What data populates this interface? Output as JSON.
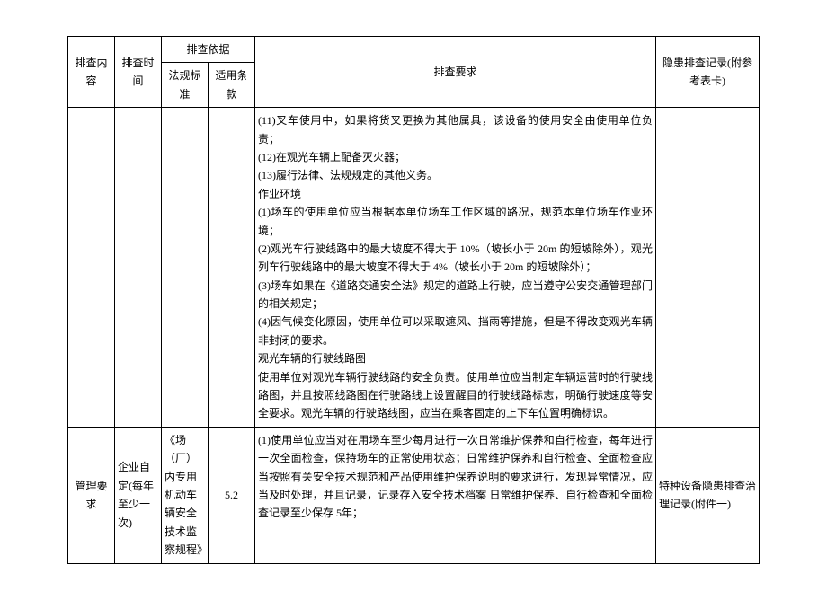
{
  "headers": {
    "col1": "排查内容",
    "col2": "排查时间",
    "col3_group": "排查依据",
    "col3a": "法规标准",
    "col3b": "适用条款",
    "col4": "排查要求",
    "col5": "隐患排查记录(附参考表卡)"
  },
  "row1": {
    "content": "",
    "time": "",
    "basis_std": "",
    "basis_clause": "",
    "req_p1": "(11)叉车使用中，如果将货叉更换为其他属具，该设备的使用安全由使用单位负责；",
    "req_p2": "(12)在观光车辆上配备灭火器；",
    "req_p3": "(13)履行法律、法规规定的其他义务。",
    "req_p4": "作业环境",
    "req_p5": "(1)场车的使用单位应当根据本单位场车工作区域的路况，规范本单位场车作业环境；",
    "req_p6": "(2)观光车行驶线路中的最大坡度不得大于 10%（坡长小于 20m 的短坡除外），观光列车行驶线路中的最大坡度不得大于 4%（坡长小于 20m 的短坡除外）；",
    "req_p7": "(3)场车如果在《道路交通安全法》规定的道路上行驶，应当遵守公安交通管理部门的相关规定；",
    "req_p8": "(4)因气候变化原因，使用单位可以采取遮风、挡雨等措施，但是不得改变观光车辆非封闭的要求。",
    "req_p9": "观光车辆的行驶线路图",
    "req_p10": "使用单位对观光车辆行驶线路的安全负责。使用单位应当制定车辆运营时的行驶线路图，并且按照线路图在行驶路线上设置醒目的行驶线路标志，明确行驶速度等安全要求。观光车辆的行驶路线图，应当在乘客固定的上下车位置明确标识。",
    "record": ""
  },
  "row2": {
    "content": "管理要求",
    "time": "企业自定(每年至少一次)",
    "basis_std": "《场（厂）内专用机动车辆安全技术监察规程》",
    "basis_clause": "5.2",
    "req_p1": "(1)使用单位应当对在用场车至少每月进行一次日常维护保养和自行检查，每年进行一次全面检查，保持场车的正常使用状态；日常维护保养和自行检查、全面检查应当按照有关安全技术规范和产品使用维护保养说明的要求进行，发现异常情况，应当及时处理，并且记录，记录存入安全技术档案  日常维护保养、自行检查和全面检查记录至少保存 5年；",
    "record": "特种设备隐患排查治理记录(附件一)"
  }
}
